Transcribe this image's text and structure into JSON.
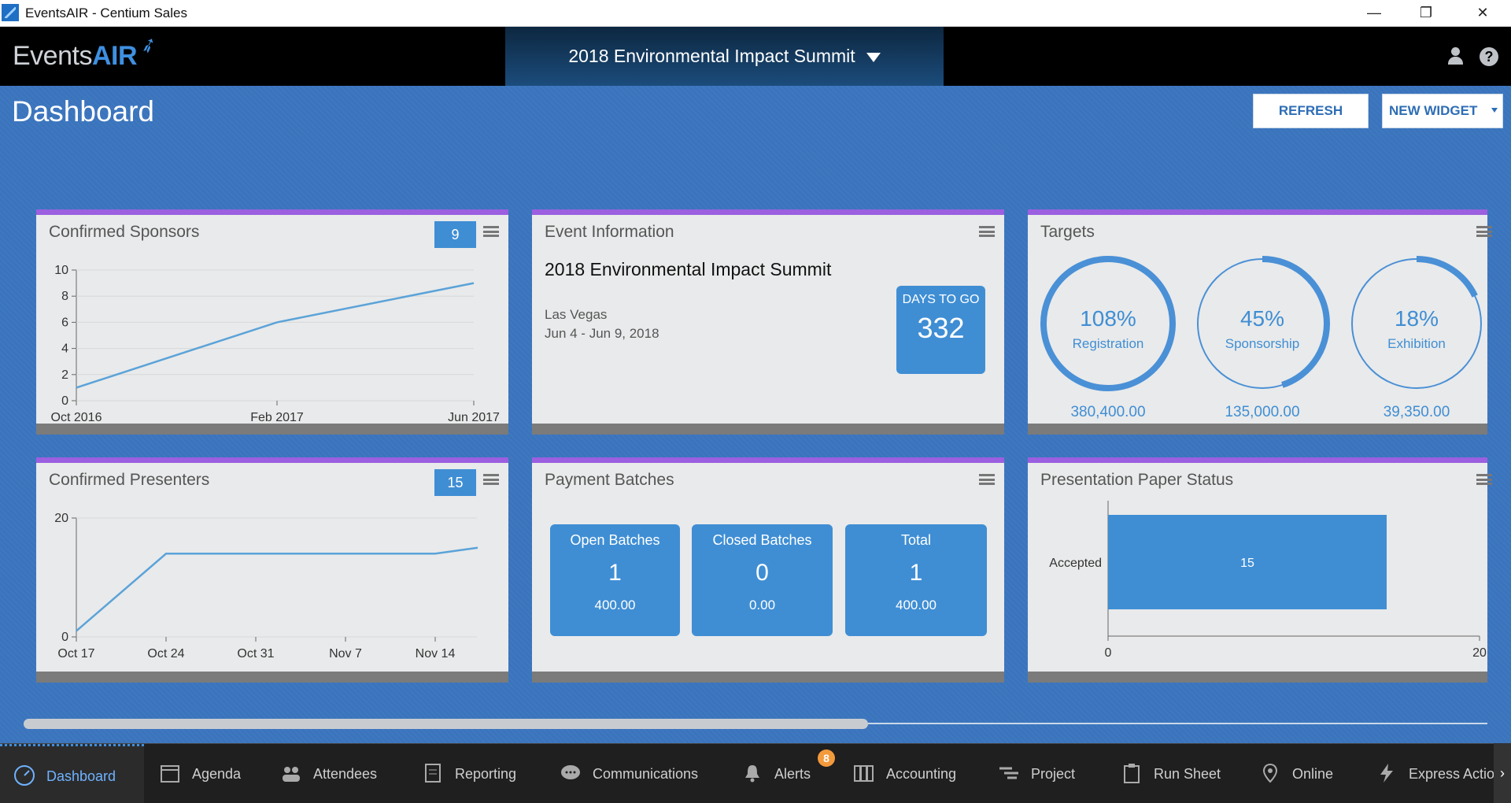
{
  "window": {
    "title": "EventsAIR - Centium Sales",
    "minimize": "—",
    "restore": "❐",
    "close": "✕"
  },
  "header": {
    "logo_prefix": "Events",
    "logo_suffix": "AIR",
    "event_selector": "2018 Environmental Impact Summit"
  },
  "page": {
    "title": "Dashboard",
    "refresh_label": "REFRESH",
    "new_widget_label": "NEW WIDGET"
  },
  "widgets": {
    "sponsors": {
      "title": "Confirmed Sponsors",
      "count": "9"
    },
    "event_info": {
      "title": "Event Information",
      "name": "2018 Environmental Impact Summit",
      "location": "Las Vegas",
      "dates": "Jun 4 - Jun 9, 2018",
      "days_label": "DAYS TO GO",
      "days_value": "332"
    },
    "targets": {
      "title": "Targets",
      "items": [
        {
          "pct": "108%",
          "name": "Registration",
          "amount": "380,400.00",
          "progress": 1.08
        },
        {
          "pct": "45%",
          "name": "Sponsorship",
          "amount": "135,000.00",
          "progress": 0.45
        },
        {
          "pct": "18%",
          "name": "Exhibition",
          "amount": "39,350.00",
          "progress": 0.18
        }
      ]
    },
    "presenters": {
      "title": "Confirmed Presenters",
      "count": "15"
    },
    "payment_batches": {
      "title": "Payment Batches",
      "items": [
        {
          "label": "Open Batches",
          "count": "1",
          "amount": "400.00"
        },
        {
          "label": "Closed Batches",
          "count": "0",
          "amount": "0.00"
        },
        {
          "label": "Total",
          "count": "1",
          "amount": "400.00"
        }
      ]
    },
    "paper_status": {
      "title": "Presentation Paper Status"
    }
  },
  "chart_data": [
    {
      "type": "line",
      "title": "Confirmed Sponsors",
      "x": [
        "Oct 2016",
        "Feb 2017",
        "Jun 2017"
      ],
      "values": [
        1,
        6,
        9
      ],
      "xticks": [
        "Oct 2016",
        "Feb 2017",
        "Jun 2017"
      ],
      "yticks": [
        0,
        2,
        4,
        6,
        8,
        10
      ],
      "ylim": [
        0,
        10
      ],
      "color": "#5ba3d9"
    },
    {
      "type": "line",
      "title": "Confirmed Presenters",
      "x": [
        "Oct 17",
        "Oct 24",
        "Oct 31",
        "Nov 7",
        "Nov 14",
        "Nov 18"
      ],
      "values": [
        1,
        14,
        14,
        14,
        14,
        15
      ],
      "xticks": [
        "Oct 17",
        "Oct 24",
        "Oct 31",
        "Nov 7",
        "Nov 14"
      ],
      "yticks": [
        0,
        20
      ],
      "ylim": [
        0,
        20
      ],
      "color": "#5ba3d9"
    },
    {
      "type": "bar",
      "title": "Presentation Paper Status",
      "orientation": "horizontal",
      "categories": [
        "Accepted"
      ],
      "values": [
        15
      ],
      "xticks": [
        "0",
        "20"
      ],
      "xlim": [
        0,
        20
      ],
      "color": "#3f8ed4"
    }
  ],
  "nav": [
    {
      "label": "Dashboard",
      "icon": "dashboard-gauge-icon",
      "active": true
    },
    {
      "label": "Agenda",
      "icon": "calendar-icon"
    },
    {
      "label": "Attendees",
      "icon": "people-icon"
    },
    {
      "label": "Reporting",
      "icon": "document-icon"
    },
    {
      "label": "Communications",
      "icon": "chat-bubble-icon"
    },
    {
      "label": "Alerts",
      "icon": "bell-icon"
    },
    {
      "label": "Accounting",
      "icon": "binders-icon"
    },
    {
      "label": "Project",
      "icon": "gantt-icon"
    },
    {
      "label": "Run Sheet",
      "icon": "clipboard-icon"
    },
    {
      "label": "Online",
      "icon": "map-pin-icon"
    },
    {
      "label": "Express Actions",
      "icon": "lightning-icon"
    }
  ],
  "alerts_badge": "8",
  "colors": {
    "accent": "#3f8ed4",
    "card_top": "#9b5fe0",
    "background": "#3a74bd"
  }
}
